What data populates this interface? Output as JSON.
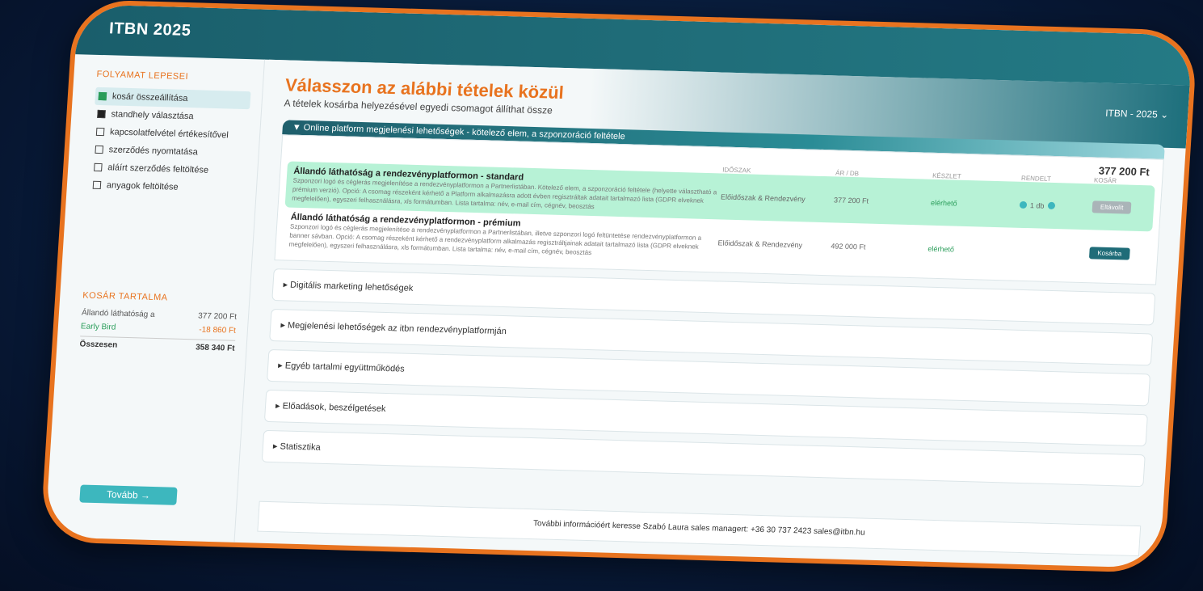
{
  "app": {
    "title": "ITBN 2025",
    "event_select": "ITBN - 2025 ⌄"
  },
  "sidebar": {
    "steps_title": "FOLYAMAT LEPESEI",
    "steps": [
      {
        "label": "kosár összeállítása",
        "state": "done"
      },
      {
        "label": "standhely választása",
        "state": "filled"
      },
      {
        "label": "kapcsolatfelvétel értékesítővel",
        "state": "empty"
      },
      {
        "label": "szerződés nyomtatása",
        "state": "empty"
      },
      {
        "label": "aláírt szerződés feltöltése",
        "state": "empty"
      },
      {
        "label": "anyagok feltöltése",
        "state": "empty"
      }
    ],
    "cart_title": "KOSÁR TARTALMA",
    "cart_rows": [
      {
        "name": "Állandó láthatóság a",
        "value": "377 200 Ft"
      },
      {
        "name": "Early Bird",
        "value": "-18 860 Ft"
      }
    ],
    "total_label": "Összesen",
    "total_value": "358 340 Ft",
    "next_label": "Tovább →"
  },
  "main": {
    "title": "Válasszon az alábbi tételek közül",
    "subtitle": "A tételek kosárba helyezésével egyedi csomagot állíthat össze",
    "open_section": "▼ Online platform megjelenési lehetőségek - kötelező elem, a szponzoráció feltétele",
    "price_top": "377 200 Ft",
    "headers": [
      "IDŐSZAK",
      "ÁR / DB",
      "KÉSZLET",
      "RENDELT",
      "KOSÁR"
    ],
    "items": [
      {
        "title": "Állandó láthatóság a rendezvényplatformon - standard",
        "desc": "Szponzori logó és céglerás megjelenítése a rendezvényplatformon a Partnerlistában. Kötelező elem, a szponzoráció feltétele (helyette választható a prémium verzió). Opció: A csomag részeként kérhető a Platform alkalmazásra adott évben regisztráltak adatait tartalmazó lista (GDPR elveknek megfelelően), egyszeri felhasználásra, xls formátumban. Lista tartalma: név, e-mail cím, cégnév, beosztás",
        "period": "Előidőszak & Rendezvény",
        "price": "377 200 Ft",
        "stock": "elérhető",
        "ordered": "1 db",
        "action": "Eltávolít"
      },
      {
        "title": "Állandó láthatóság a rendezvényplatformon - prémium",
        "desc": "Szponzori logó és céglerás megjelenítése a rendezvényplatformon a Partnerlistában, illetve szponzori logó feltüntetése rendezvényplatformon a banner sávban. Opció: A csomag részeként kérhető a rendezvényplatform alkalmazás regisztráltjainak adatait tartalmazó lista (GDPR elveknek megfelelően), egyszeri felhasználásra, xls formátumban. Lista tartalma: név, e-mail cím, cégnév, beosztás",
        "period": "Előidőszak & Rendezvény",
        "price": "492 000 Ft",
        "stock": "elérhető",
        "ordered": "",
        "action": "Kosárba"
      }
    ],
    "sections": [
      "▸ Digitális marketing lehetőségek",
      "▸ Megjelenési lehetőségek az itbn rendezvényplatformján",
      "▸ Egyéb tartalmi együttműködés",
      "▸ Előadások, beszélgetések",
      "▸ Statisztika"
    ],
    "footer": "További információért keresse Szabó Laura sales managert:  +36 30 737 2423   sales@itbn.hu"
  }
}
